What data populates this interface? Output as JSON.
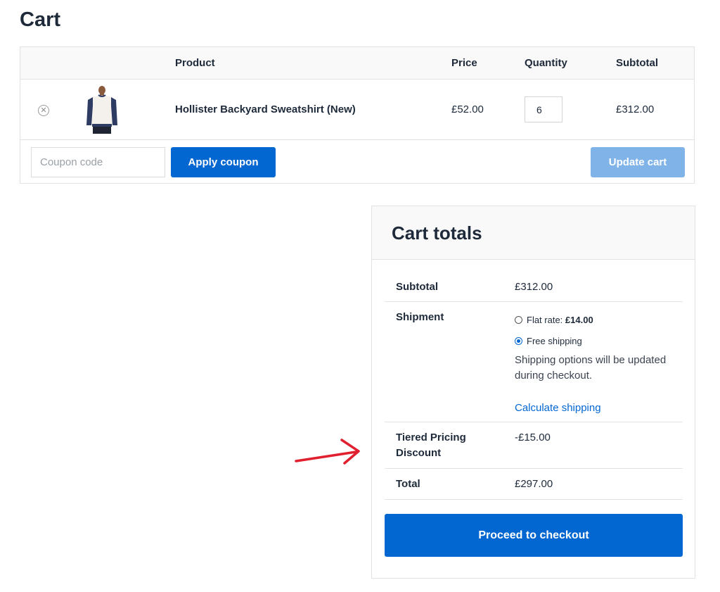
{
  "page": {
    "title": "Cart"
  },
  "cart_table": {
    "headers": {
      "product": "Product",
      "price": "Price",
      "quantity": "Quantity",
      "subtotal": "Subtotal"
    },
    "rows": [
      {
        "remove_icon": "close-circle-icon",
        "product_name": "Hollister Backyard Sweatshirt (New)",
        "price": "£52.00",
        "quantity": "6",
        "subtotal": "£312.00"
      }
    ]
  },
  "actions": {
    "coupon_placeholder": "Coupon code",
    "apply_coupon_label": "Apply coupon",
    "update_cart_label": "Update cart"
  },
  "totals": {
    "title": "Cart totals",
    "subtotal_label": "Subtotal",
    "subtotal_value": "£312.00",
    "shipment_label": "Shipment",
    "shipping_options": [
      {
        "label": "Flat rate: ",
        "amount": "£14.00",
        "selected": false
      },
      {
        "label": "Free shipping",
        "amount": "",
        "selected": true
      }
    ],
    "shipping_note": "Shipping options will be updated during checkout.",
    "calculate_shipping": "Calculate shipping",
    "discount_label": "Tiered Pricing Discount",
    "discount_value": "-£15.00",
    "total_label": "Total",
    "total_value": "£297.00",
    "checkout_label": "Proceed to checkout"
  },
  "colors": {
    "primary": "#0367d1",
    "disabled_primary": "#80b3e8",
    "annotation_arrow": "#e0202e"
  },
  "annotation": {
    "icon": "red-arrow-icon"
  }
}
